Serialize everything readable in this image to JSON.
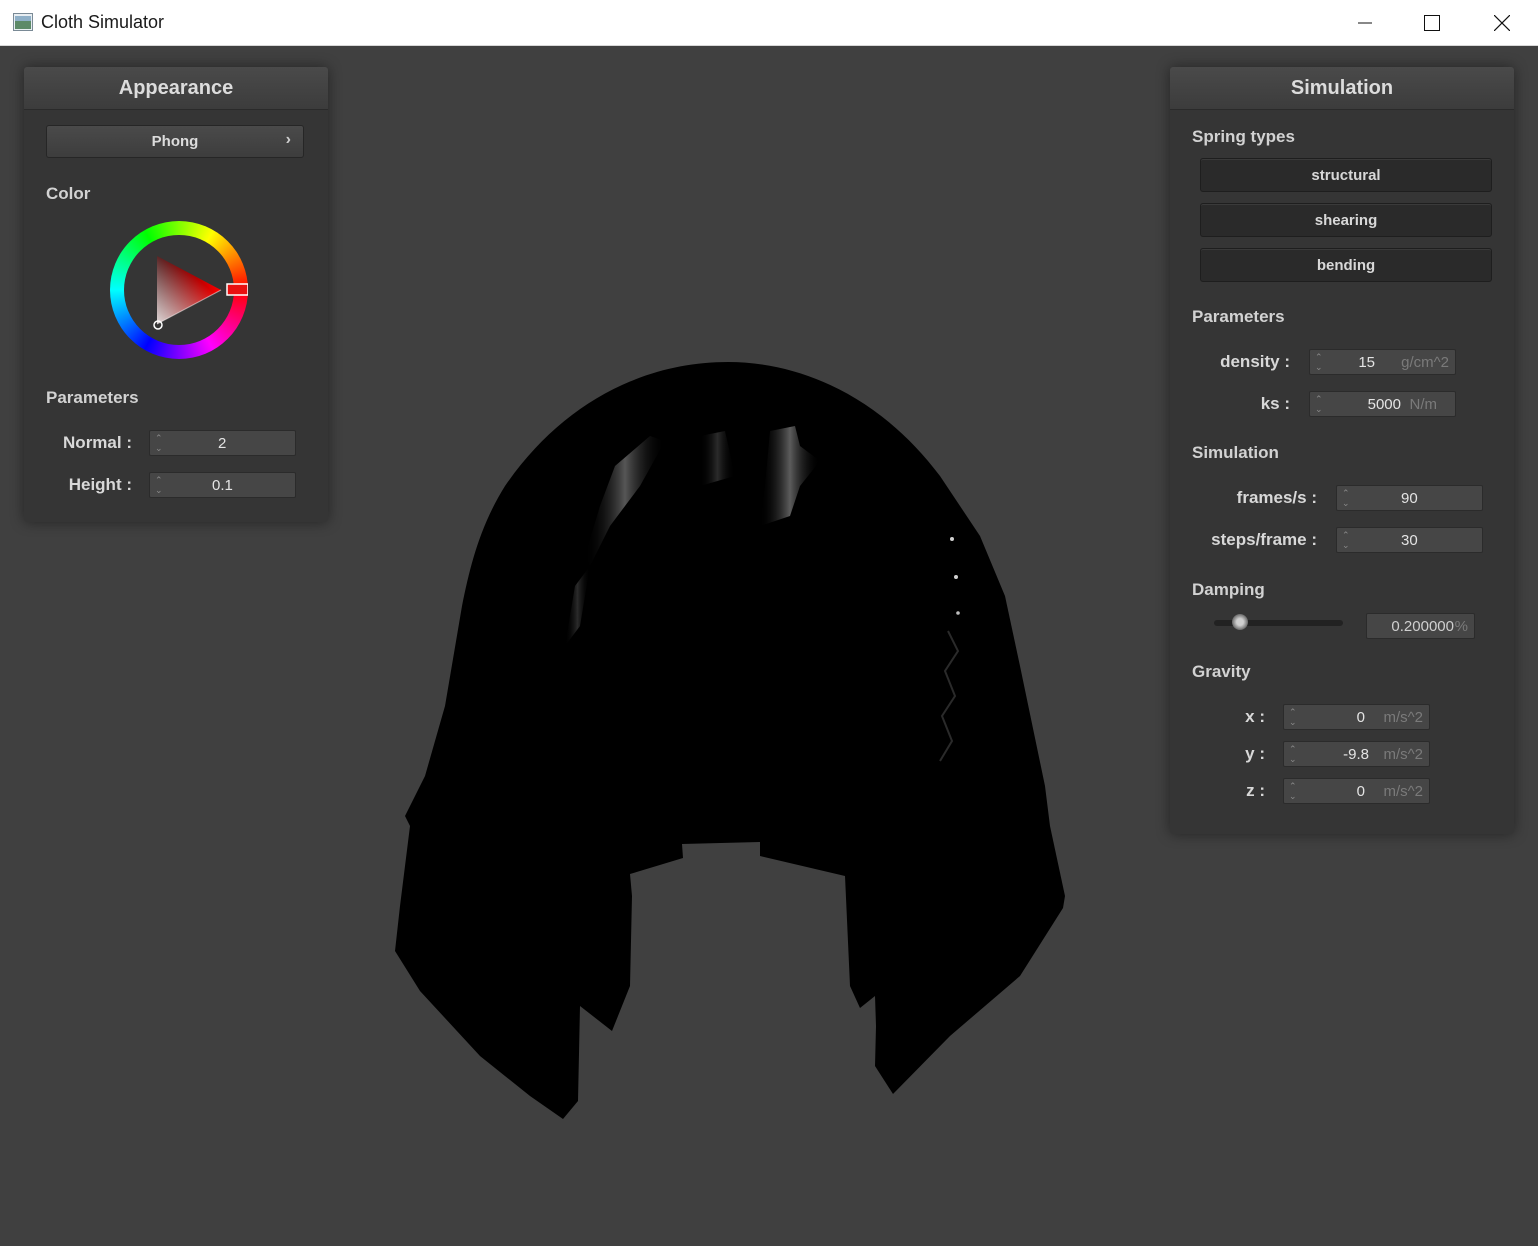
{
  "window": {
    "title": "Cloth Simulator"
  },
  "appearance": {
    "title": "Appearance",
    "shader": "Phong",
    "color_label": "Color",
    "color_value": "#ff0000",
    "params_label": "Parameters",
    "normal_label": "Normal :",
    "normal_value": "2",
    "height_label": "Height :",
    "height_value": "0.1"
  },
  "simulation": {
    "title": "Simulation",
    "spring_types_label": "Spring types",
    "structural": "structural",
    "shearing": "shearing",
    "bending": "bending",
    "params_label": "Parameters",
    "density_label": "density :",
    "density_value": "15",
    "density_unit": "g/cm^2",
    "ks_label": "ks :",
    "ks_value": "5000",
    "ks_unit": "N/m",
    "sim_label": "Simulation",
    "fps_label": "frames/s :",
    "fps_value": "90",
    "steps_label": "steps/frame :",
    "steps_value": "30",
    "damping_label": "Damping",
    "damping_value": "0.200000",
    "damping_unit": "%",
    "damping_fraction": 0.2,
    "gravity_label": "Gravity",
    "gx_label": "x :",
    "gx_value": "0",
    "gy_label": "y :",
    "gy_value": "-9.8",
    "gz_label": "z :",
    "gz_value": "0",
    "g_unit": "m/s^2"
  }
}
